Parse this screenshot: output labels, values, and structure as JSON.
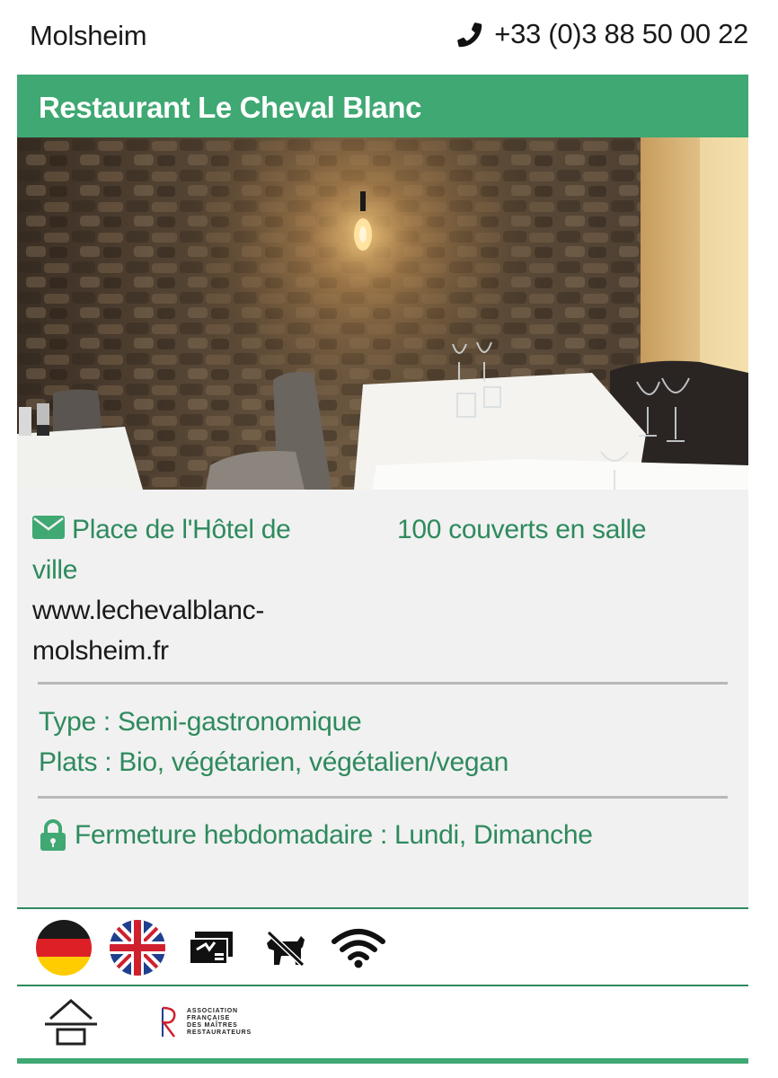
{
  "header": {
    "city": "Molsheim",
    "phone": "+33 (0)3 88 50 00 22",
    "phone_icon": "phone-icon"
  },
  "restaurant": {
    "name": "Restaurant Le Cheval Blanc"
  },
  "photo": {
    "description_icon": "restaurant-dining-room-photo"
  },
  "info": {
    "address_line1": "Place de l'Hôtel de",
    "address_line2": "ville",
    "website_line1": "www.lechevalblanc-",
    "website_line2": "molsheim.fr",
    "capacity": "100 couverts en salle",
    "type": "Type : Semi-gastronomique",
    "dishes": "Plats : Bio, végétarien, végétalien/vegan",
    "closing": "Fermeture hebdomadaire : Lundi, Dimanche"
  },
  "services": [
    {
      "icon": "german-flag-icon"
    },
    {
      "icon": "uk-flag-icon"
    },
    {
      "icon": "holiday-voucher-icon"
    },
    {
      "icon": "no-dogs-icon"
    },
    {
      "icon": "wifi-icon"
    }
  ],
  "labels": {
    "maitres_line1": "ASSOCIATION",
    "maitres_line2": "FRANÇAISE",
    "maitres_line3": "DES MAÎTRES",
    "maitres_line4": "RESTAURATEURS"
  },
  "colors": {
    "accent_green": "#3fa873",
    "text_green": "#2e8a5d",
    "info_background": "#f1f1f1"
  }
}
